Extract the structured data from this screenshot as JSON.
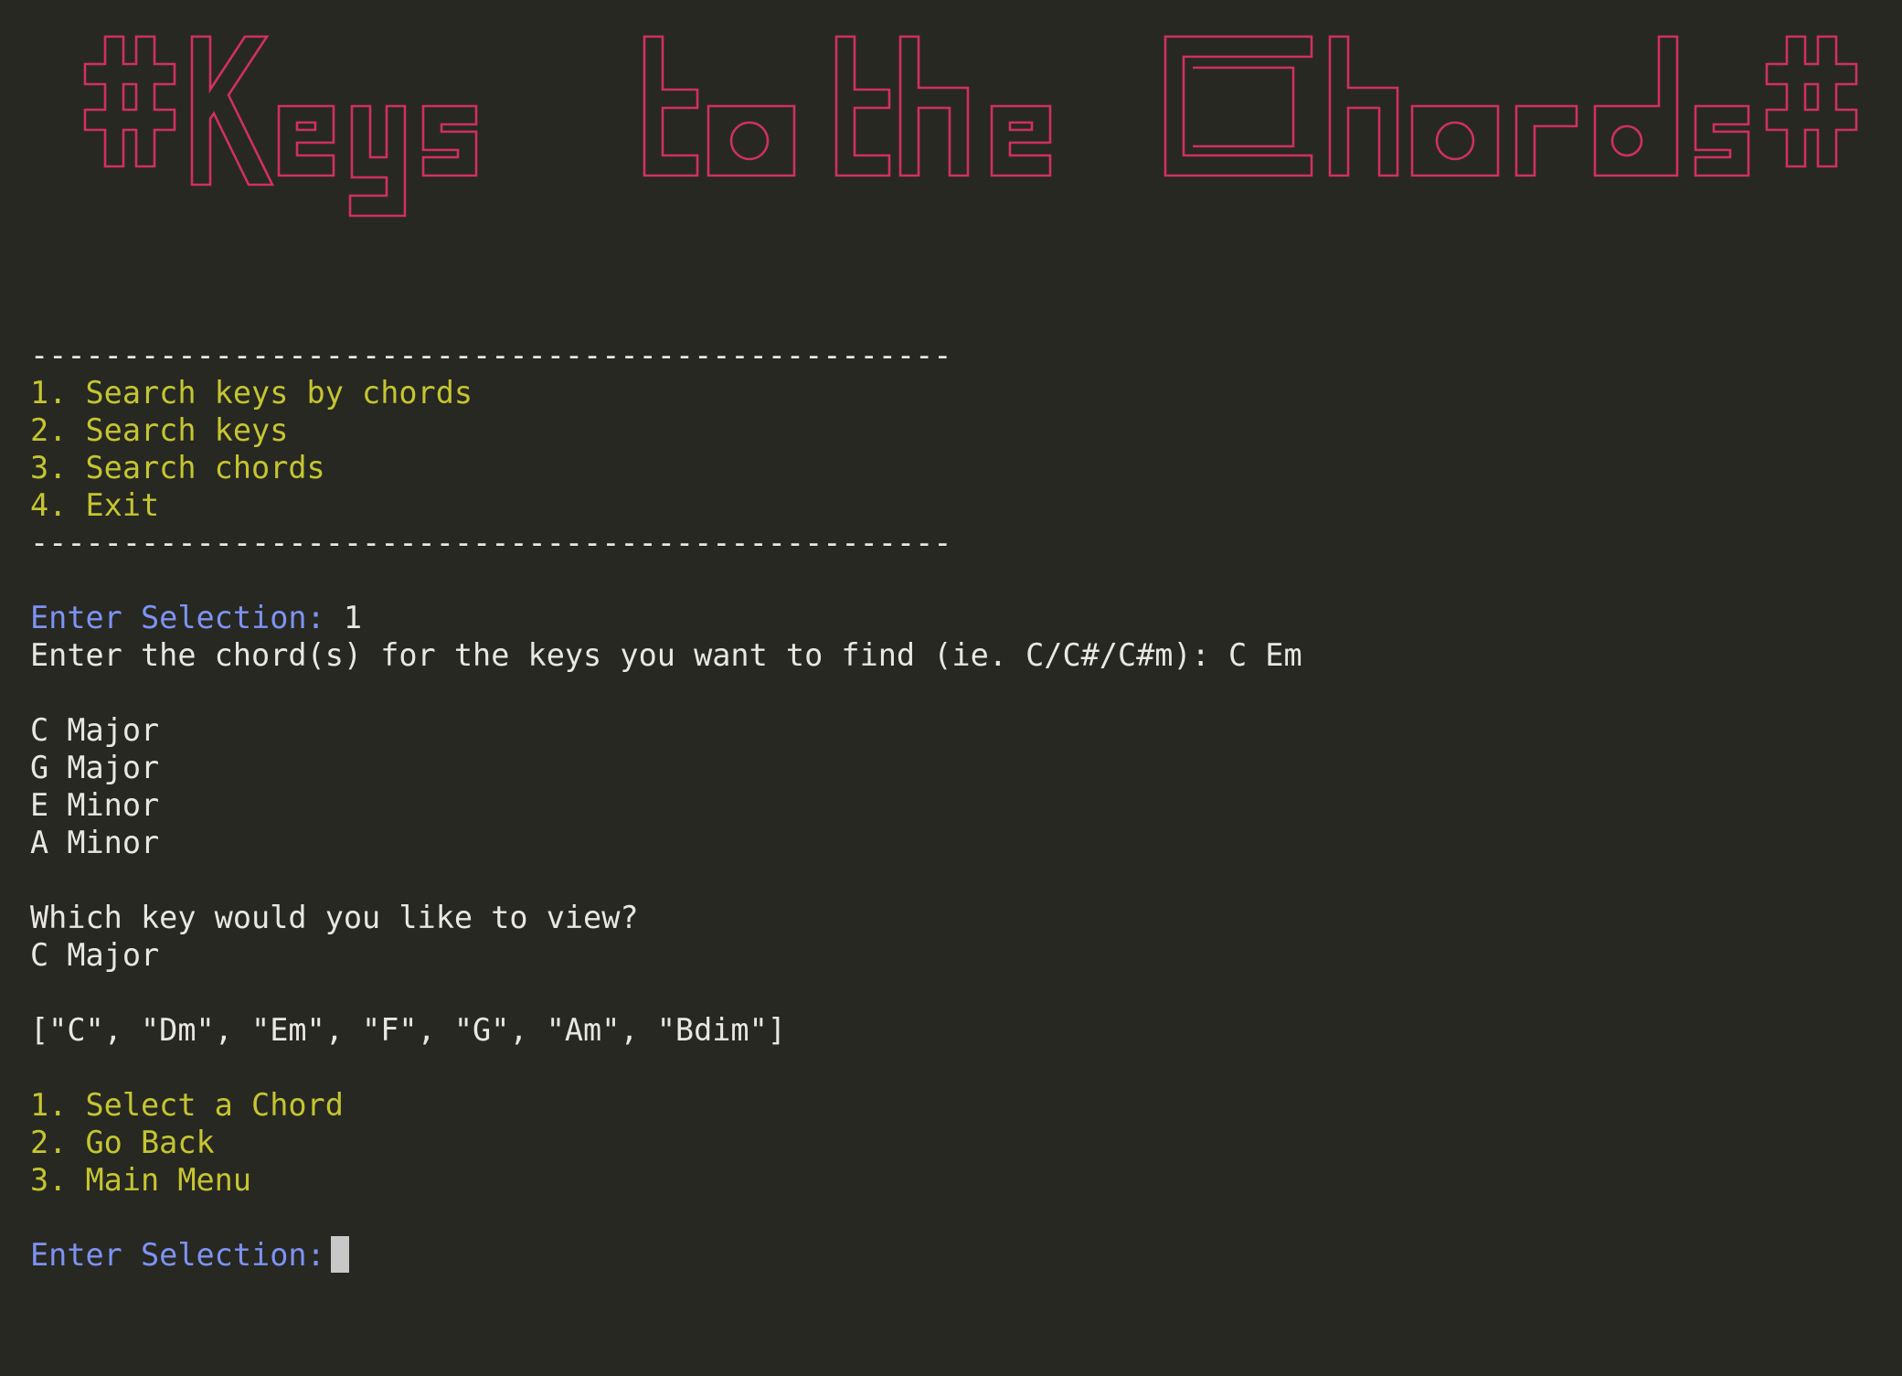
{
  "banner": {
    "title": "#Keys to the Chords#",
    "color": "#d0305f"
  },
  "separator": "--------------------------------------------------",
  "main_menu": {
    "items": [
      "1. Search keys by chords",
      "2. Search keys",
      "3. Search chords",
      "4. Exit"
    ]
  },
  "prompt1": {
    "label": "Enter Selection:",
    "value": "1"
  },
  "chord_prompt": {
    "label": "Enter the chord(s) for the keys you want to find (ie. C/C#/C#m):",
    "value": "C Em"
  },
  "results": [
    "C Major",
    "G Major",
    "E Minor",
    "A Minor"
  ],
  "which_key": {
    "question": "Which key would you like to view?",
    "answer": "C Major"
  },
  "chord_list": "[\"C\", \"Dm\", \"Em\", \"F\", \"G\", \"Am\", \"Bdim\"]",
  "sub_menu": {
    "items": [
      "1. Select a Chord",
      "2. Go Back",
      "3. Main Menu"
    ]
  },
  "prompt2": {
    "label": "Enter Selection:"
  },
  "colors": {
    "background": "#272822",
    "menu_yellow": "#c5c531",
    "prompt_blue": "#7d93f3",
    "text": "#e8e8e0",
    "banner_pink": "#d0305f"
  }
}
